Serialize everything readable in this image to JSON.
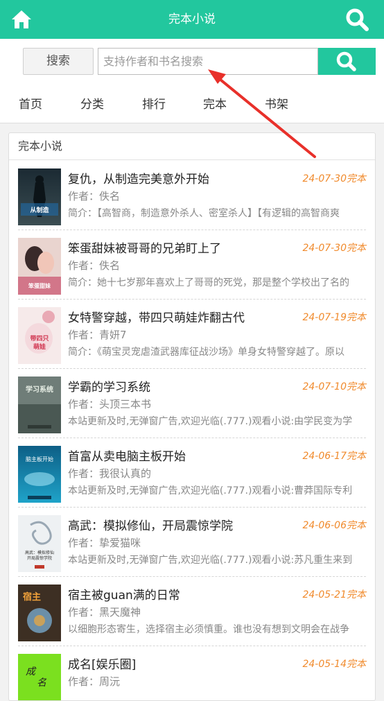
{
  "header": {
    "title": "完本小说",
    "home_icon": "home-icon",
    "search_icon": "search-icon",
    "color": "#22c79e"
  },
  "search": {
    "button_label": "搜索",
    "placeholder": "支持作者和书名搜索",
    "value": ""
  },
  "nav": {
    "items": [
      "首页",
      "分类",
      "排行",
      "完本",
      "书架"
    ]
  },
  "panel": {
    "title": "完本小说"
  },
  "books": [
    {
      "title": "复仇，从制造完美意外开始",
      "date": "24-07-30完本",
      "author": "作者：佚名",
      "desc": "简介：【高智商，制造意外杀人、密室杀人】【有逻辑的高智商爽",
      "cover_text": "从制造完美意外开始"
    },
    {
      "title": "笨蛋甜妹被哥哥的兄弟盯上了",
      "date": "24-07-30完本",
      "author": "作者：佚名",
      "desc": "简介：她十七岁那年喜欢上了哥哥的死党，那是整个学校出了名的",
      "cover_text": "笨蛋甜妹被哥哥的兄弟盯上了"
    },
    {
      "title": "女特警穿越，带四只萌娃炸翻古代",
      "date": "24-07-19完本",
      "author": "作者：青妍7",
      "desc": "简介：《萌宝灵宠虐渣武器库征战沙场》单身女特警穿越了。原以",
      "cover_text": "带四只萌娃炸翻古代"
    },
    {
      "title": "学霸的学习系统",
      "date": "24-07-10完本",
      "author": "作者：头顶三本书",
      "desc": "本站更新及时,无弹窗广告,欢迎光临(.777.)观看小说:由学民变为学",
      "cover_text": "学习系统"
    },
    {
      "title": "首富从卖电脑主板开始",
      "date": "24-06-17完本",
      "author": "作者：我很认真的",
      "desc": "本站更新及时,无弹窗广告,欢迎光临(.777.)观看小说:曹莽国际专利",
      "cover_text": "首富从卖电脑主板开始"
    },
    {
      "title": "高武：模拟修仙，开局震惊学院",
      "date": "24-06-06完本",
      "author": "作者：挚爱猫咪",
      "desc": "本站更新及时,无弹窗广告,欢迎光临(.777.)观看小说:苏凡重生来到",
      "cover_text": "高武：模拟修仙，开局震惊学院"
    },
    {
      "title": "宿主被guan满的日常",
      "date": "24-05-21完本",
      "author": "作者：黑天魔神",
      "desc": "以细胞形态寄生，选择宿主必须慎重。谁也没有想到文明会在战争",
      "cover_text": "宿主"
    },
    {
      "title": "成名[娱乐圈]",
      "date": "24-05-14完本",
      "author": "作者：周沅",
      "desc": "",
      "cover_text": "成名"
    }
  ]
}
